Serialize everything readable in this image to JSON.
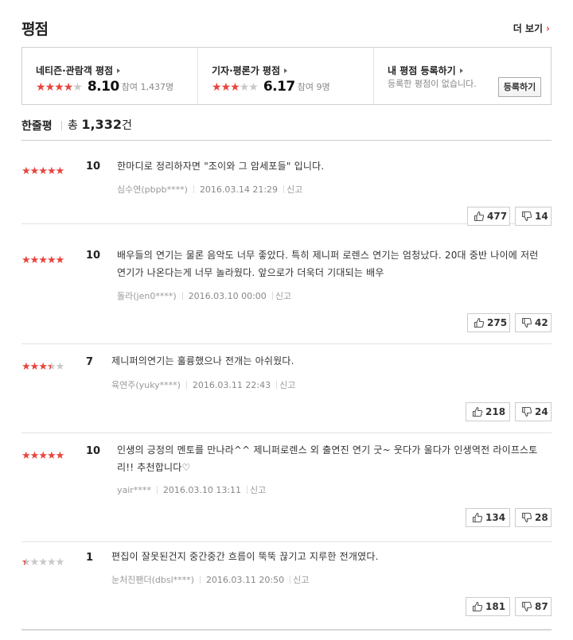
{
  "header": {
    "title": "평점",
    "more_label": "더 보기"
  },
  "summary": {
    "netizen": {
      "label": "네티즌·관람객 평점",
      "score": "8.10",
      "participants": "참여 1,437명",
      "stars": 4.05
    },
    "critic": {
      "label": "기자·평론가 평점",
      "score": "6.17",
      "participants": "참여 9명",
      "stars": 3.085
    },
    "mine": {
      "label": "내 평점 등록하기",
      "desc": "등록한 평점이 없습니다.",
      "button": "등록하기"
    }
  },
  "hanjul": {
    "title": "한줄평",
    "total_prefix": "총",
    "total_count": "1,332",
    "total_suffix": "건"
  },
  "reviews": [
    {
      "stars": 5,
      "score": "10",
      "text": "한마디로 정리하자면 \"조이와 그 암세포들\" 입니다.",
      "user": "심수연(pbpb****)",
      "date": "2016.03.14 21:29",
      "report": "신고",
      "likes": "477",
      "dislikes": "14"
    },
    {
      "stars": 5,
      "score": "10",
      "text": "배우들의 연기는 물론 음악도 너무 좋았다. 특히 제니퍼 로렌스 연기는 엄청났다. 20대 중반 나이에 저런 연기가 나온다는게 너무 놀라웠다. 앞으로가 더욱더 기대되는 배우",
      "user": "돌라(jen0****)",
      "date": "2016.03.10 00:00",
      "report": "신고",
      "likes": "275",
      "dislikes": "42"
    },
    {
      "stars": 3.5,
      "score": "7",
      "text": "제니퍼의연기는 훌륭했으나 전개는 아쉬웠다.",
      "user": "육연주(yuky****)",
      "date": "2016.03.11 22:43",
      "report": "신고",
      "likes": "218",
      "dislikes": "24"
    },
    {
      "stars": 5,
      "score": "10",
      "text": "인생의 긍정의 멘토를 만나라^^ 제니퍼로렌스 외 출연진 연기 굿~ 웃다가 울다가 인생역전 라이프스토리!! 추천합니다♡",
      "user": "yair****",
      "date": "2016.03.10 13:11",
      "report": "신고",
      "likes": "134",
      "dislikes": "28"
    },
    {
      "stars": 0.5,
      "score": "1",
      "text": "편집이 잘못된건지 중간중간 흐름이 뚝뚝 끊기고 지루한 전개였다.",
      "user": "눈처진팬더(dbsl****)",
      "date": "2016.03.11 20:50",
      "report": "신고",
      "likes": "181",
      "dislikes": "87"
    }
  ]
}
